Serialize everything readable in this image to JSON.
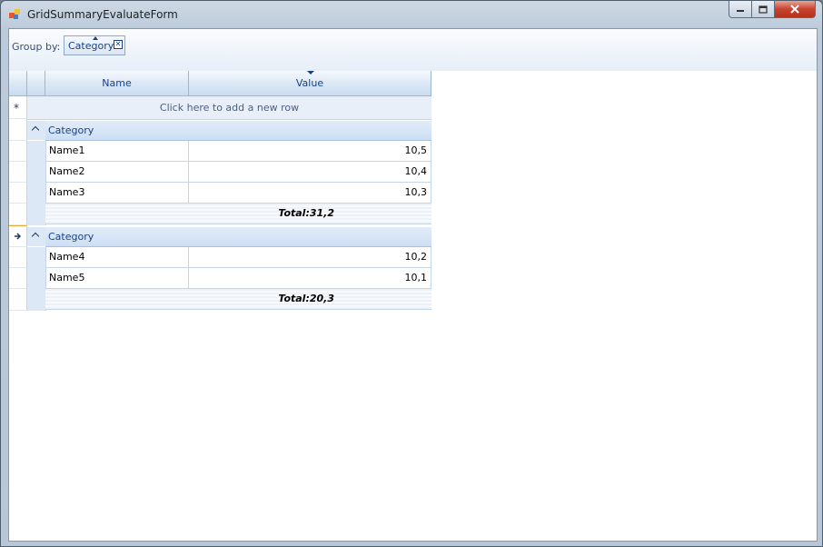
{
  "window": {
    "title": "GridSummaryEvaluateForm",
    "minimize_icon": "minimize-icon",
    "maximize_icon": "maximize-icon",
    "close_icon": "close-icon"
  },
  "groupbar": {
    "label": "Group by:",
    "chips": [
      {
        "label": "Category"
      }
    ]
  },
  "grid": {
    "columns": [
      {
        "label": "Name"
      },
      {
        "label": "Value"
      }
    ],
    "new_row_text": "Click here to add a new row",
    "new_row_marker": "*",
    "groups": [
      {
        "label": "Category",
        "rows": [
          {
            "name": "Name1",
            "value": "10,5"
          },
          {
            "name": "Name2",
            "value": "10,4"
          },
          {
            "name": "Name3",
            "value": "10,3"
          }
        ],
        "summary": "Total:31,2"
      },
      {
        "label": "Category",
        "rows": [
          {
            "name": "Name4",
            "value": "10,2"
          },
          {
            "name": "Name5",
            "value": "10,1"
          }
        ],
        "summary": "Total:20,3"
      }
    ]
  },
  "colors": {
    "header": "#cadcf1",
    "group_row": "#dce8f6",
    "text": "#15428b"
  }
}
